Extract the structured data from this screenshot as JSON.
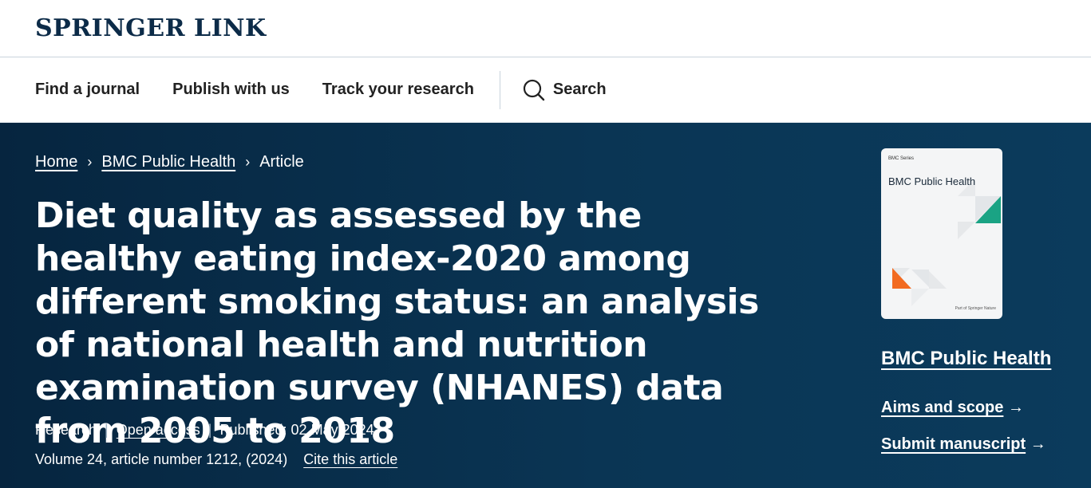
{
  "header": {
    "logo_part1": "SPRINGER",
    "logo_part2": "LINK"
  },
  "nav": {
    "items": [
      {
        "label": "Find a journal"
      },
      {
        "label": "Publish with us"
      },
      {
        "label": "Track your research"
      }
    ],
    "search_label": "Search"
  },
  "breadcrumb": {
    "home": "Home",
    "journal": "BMC Public Health",
    "current": "Article"
  },
  "article": {
    "title": "Diet quality as assessed by the healthy eating index-2020 among different smoking status: an analysis of national health and nutrition examination survey (NHANES) data from 2005 to 2018",
    "type": "Research",
    "access": "Open access",
    "published": "Published: 02 May 2024",
    "volume": "Volume 24, article number 1212, (2024)",
    "cite": "Cite this article"
  },
  "sidebar": {
    "cover_series": "BMC Series",
    "cover_title": "BMC Public Health",
    "cover_publisher": "Part of Springer Nature",
    "journal_name": "BMC Public Health",
    "aims_label": "Aims and scope",
    "submit_label": "Submit manuscript"
  },
  "colors": {
    "hero_bg": "#0a3554",
    "logo": "#0c2b48",
    "cover_green": "#1aa384",
    "cover_orange": "#f26b21"
  }
}
